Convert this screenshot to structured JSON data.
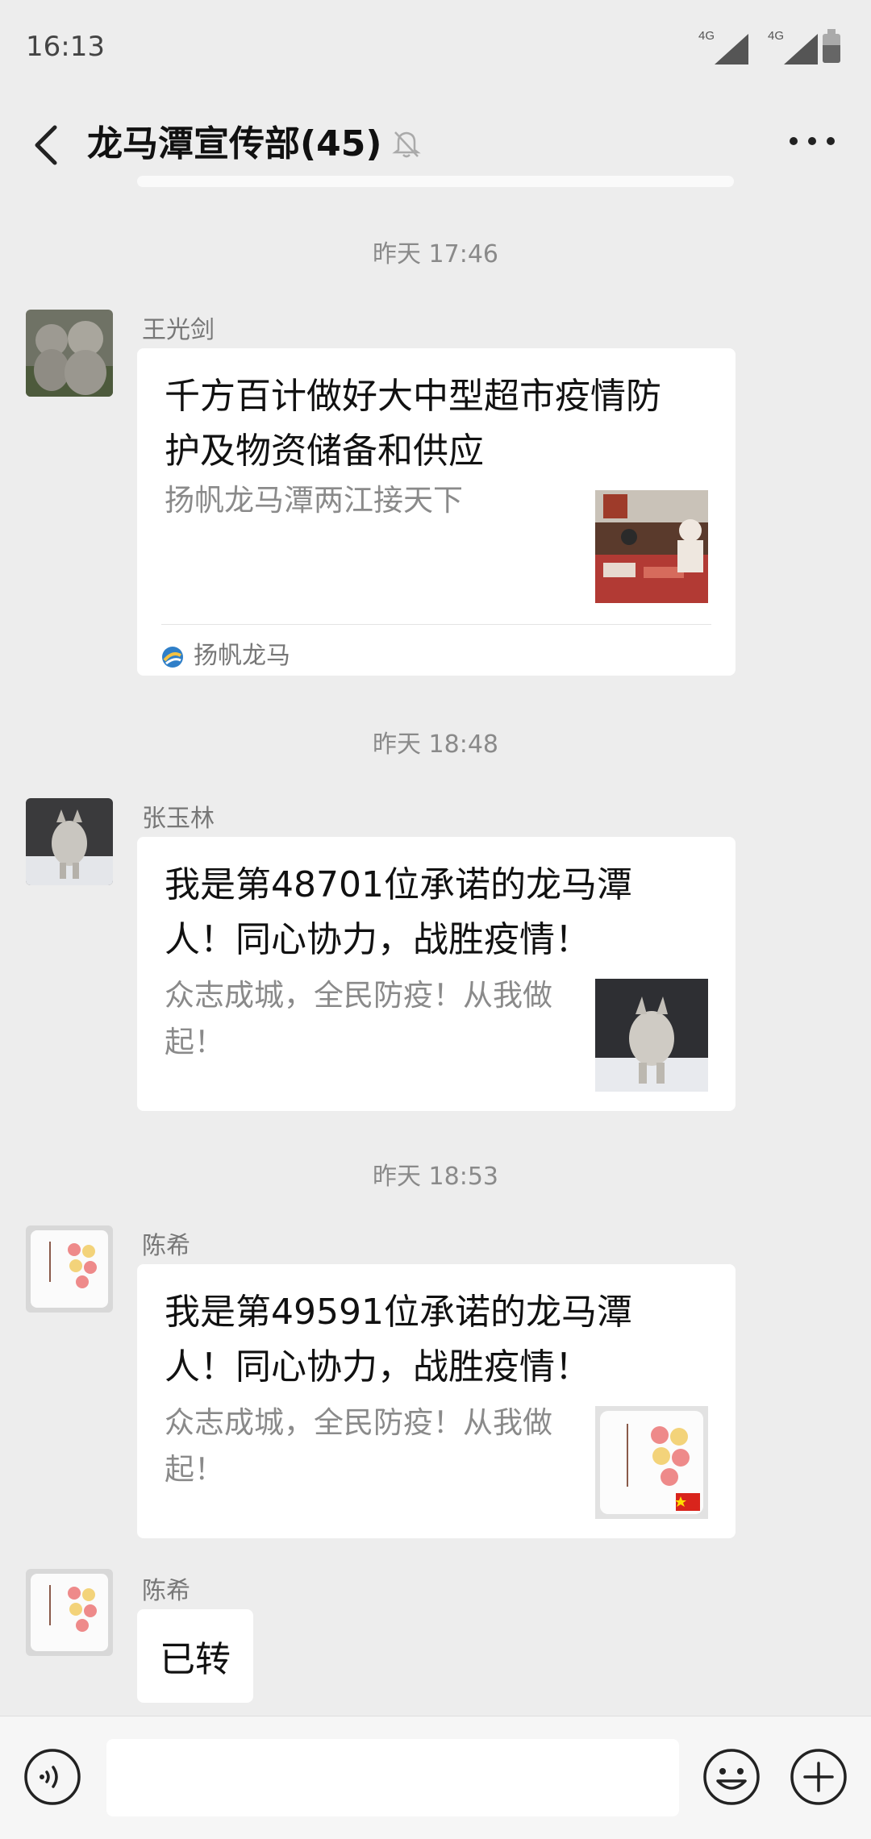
{
  "status_bar": {
    "time": "16:13",
    "network1": "4G",
    "network2": "4G",
    "battery_level": 0.6
  },
  "header": {
    "title": "龙马潭宣传部(45)",
    "back_icon": "back-arrow-icon",
    "mute_icon": "bell-muted-icon",
    "more_icon": "more-dots-icon"
  },
  "messages": [
    {
      "timestamp": "昨天 17:46",
      "sender": "王光剑",
      "type": "article",
      "title": "千方百计做好大中型超市疫情防护及物资储备和供应",
      "description": "扬帆龙马潭两江接天下",
      "source": "扬帆龙马"
    },
    {
      "timestamp": "昨天 18:48",
      "sender": "张玉林",
      "type": "article",
      "title": "我是第48701位承诺的龙马潭人！同心协力，战胜疫情！",
      "description": "众志成城，全民防疫！从我做起！"
    },
    {
      "timestamp": "昨天 18:53",
      "sender": "陈希",
      "type": "article",
      "title": "我是第49591位承诺的龙马潭人！同心协力，战胜疫情！",
      "description": "众志成城，全民防疫！从我做起！"
    },
    {
      "sender": "陈希",
      "type": "text",
      "text": "已转"
    }
  ],
  "input_bar": {
    "voice_icon": "voice-icon",
    "emoji_icon": "emoji-icon",
    "plus_icon": "plus-icon",
    "value": ""
  },
  "colors": {
    "background": "#ededed",
    "bubble": "#ffffff",
    "meta_text": "#8a8a8a"
  }
}
